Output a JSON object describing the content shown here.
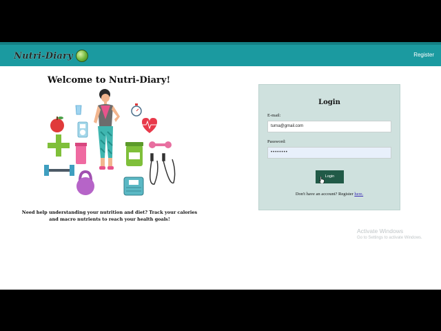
{
  "header": {
    "logo_text": "Nutri-Diary",
    "register_link": "Register"
  },
  "hero": {
    "welcome_title": "Welcome to Nutri-Diary!",
    "tagline": "Need help understanding your nutrition and diet? Track your calories and macro nutrients to reach your health goals!"
  },
  "login": {
    "title": "Login",
    "email_label": "E-mail:",
    "email_value": "turna@gmail.com",
    "password_label": "Password:",
    "password_value": "••••••••",
    "button_label": "Login",
    "no_account_text": "Don't have an account? Register ",
    "register_here": "here."
  },
  "watermark": {
    "line1": "Activate Windows",
    "line2": "Go to Settings to activate Windows."
  },
  "colors": {
    "topbar": "#1b9aa0",
    "card_bg": "#cfe1de",
    "login_button": "#215a47"
  }
}
